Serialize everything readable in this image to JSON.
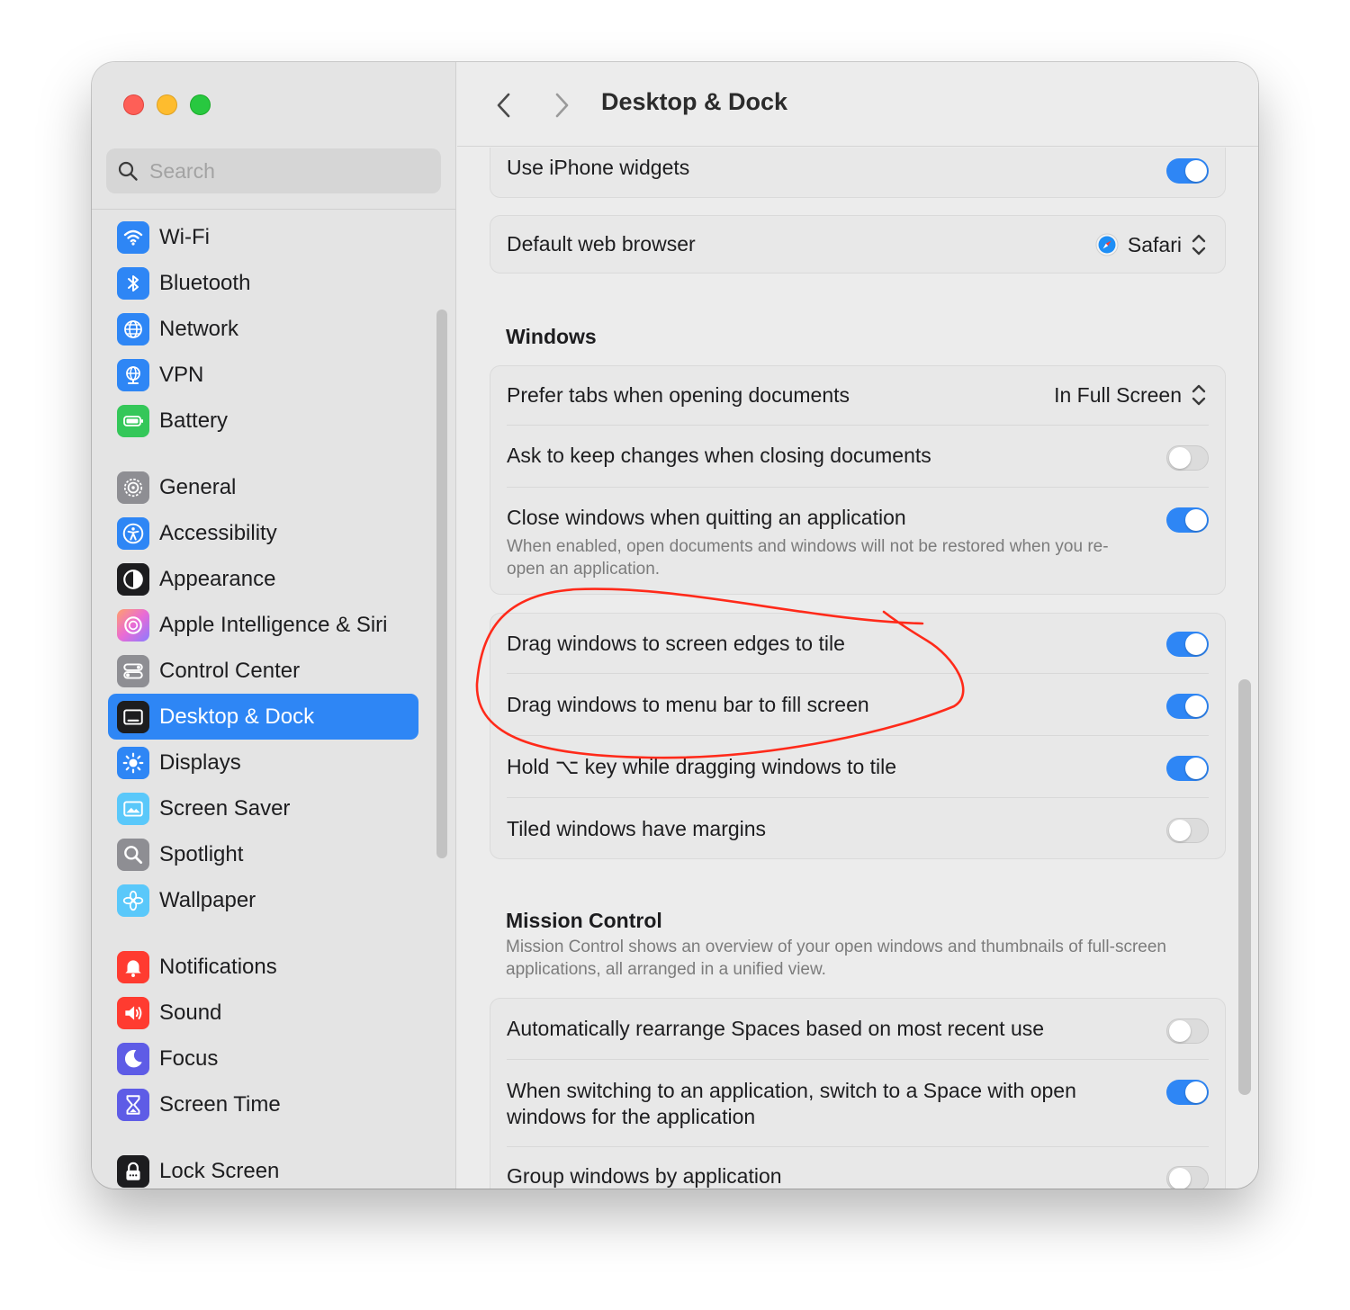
{
  "window": {
    "traffic_lights": {
      "close": "#fe5f57",
      "minimize": "#febc2e",
      "zoom": "#28c840"
    }
  },
  "search": {
    "placeholder": "Search"
  },
  "sidebar": {
    "groups": [
      [
        {
          "label": "Wi-Fi",
          "icon": "wifi-icon",
          "color": "#2e86f5"
        },
        {
          "label": "Bluetooth",
          "icon": "bluetooth-icon",
          "color": "#2e86f5"
        },
        {
          "label": "Network",
          "icon": "globe-icon",
          "color": "#2e86f5"
        },
        {
          "label": "VPN",
          "icon": "vpn-globe-icon",
          "color": "#2e86f5"
        },
        {
          "label": "Battery",
          "icon": "battery-icon",
          "color": "#34c759"
        }
      ],
      [
        {
          "label": "General",
          "icon": "gear-icon",
          "color": "#8e8e93"
        },
        {
          "label": "Accessibility",
          "icon": "accessibility-icon",
          "color": "#2e86f5"
        },
        {
          "label": "Appearance",
          "icon": "appearance-icon",
          "color": "#1d1d1f"
        },
        {
          "label": "Apple Intelligence & Siri",
          "icon": "siri-icon",
          "color": "#e98bd8"
        },
        {
          "label": "Control Center",
          "icon": "control-center-icon",
          "color": "#8e8e93"
        },
        {
          "label": "Desktop & Dock",
          "icon": "desktop-dock-icon",
          "color": "#1d1d1f",
          "active": true
        },
        {
          "label": "Displays",
          "icon": "displays-icon",
          "color": "#2e86f5"
        },
        {
          "label": "Screen Saver",
          "icon": "screen-saver-icon",
          "color": "#5ac8fa"
        },
        {
          "label": "Spotlight",
          "icon": "spotlight-icon",
          "color": "#8e8e93"
        },
        {
          "label": "Wallpaper",
          "icon": "wallpaper-icon",
          "color": "#5ac8fa"
        }
      ],
      [
        {
          "label": "Notifications",
          "icon": "notifications-icon",
          "color": "#ff3b30"
        },
        {
          "label": "Sound",
          "icon": "sound-icon",
          "color": "#ff3b30"
        },
        {
          "label": "Focus",
          "icon": "focus-moon-icon",
          "color": "#5e5ce6"
        },
        {
          "label": "Screen Time",
          "icon": "screen-time-icon",
          "color": "#5e5ce6"
        }
      ],
      [
        {
          "label": "Lock Screen",
          "icon": "lock-icon",
          "color": "#1d1d1f"
        }
      ]
    ]
  },
  "header": {
    "title": "Desktop & Dock"
  },
  "main": {
    "widgets_row": {
      "label": "Use iPhone widgets",
      "on": true
    },
    "browser_row": {
      "label": "Default web browser",
      "value": "Safari"
    },
    "windows": {
      "heading": "Windows",
      "prefer_tabs": {
        "label": "Prefer tabs when opening documents",
        "value": "In Full Screen"
      },
      "ask_keep": {
        "label": "Ask to keep changes when closing documents",
        "on": false
      },
      "close_windows": {
        "label": "Close windows when quitting an application",
        "description": "When enabled, open documents and windows will not be restored when you re-open an application.",
        "on": true
      }
    },
    "tiling": {
      "edges": {
        "label": "Drag windows to screen edges to tile",
        "on": true
      },
      "menubar": {
        "label": "Drag windows to menu bar to fill screen",
        "on": true
      },
      "hold_key": {
        "label": "Hold ⌥ key while dragging windows to tile",
        "on": true
      },
      "margins": {
        "label": "Tiled windows have margins",
        "on": false
      }
    },
    "mission_control": {
      "heading": "Mission Control",
      "description": "Mission Control shows an overview of your open windows and thumbnails of full-screen applications, all arranged in a unified view.",
      "rearrange": {
        "label": "Automatically rearrange Spaces based on most recent use",
        "on": false
      },
      "switch_space": {
        "label": "When switching to an application, switch to a Space with open windows for the application",
        "on": true
      },
      "group": {
        "label": "Group windows by application",
        "on": false
      }
    }
  },
  "annotation": {
    "color": "#ff2a1a"
  }
}
